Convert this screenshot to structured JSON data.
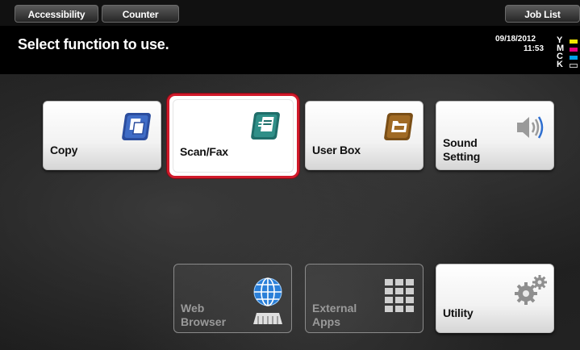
{
  "topbar": {
    "accessibility_label": "Accessibility",
    "counter_label": "Counter",
    "job_list_label": "Job List"
  },
  "message": {
    "text": "Select function to use.",
    "date": "09/18/2012",
    "time": "11:53"
  },
  "toner": [
    {
      "letter": "Y",
      "color": "#f2e600"
    },
    {
      "letter": "M",
      "color": "#e6007e"
    },
    {
      "letter": "C",
      "color": "#00a0e9"
    },
    {
      "letter": "K",
      "color": "#222222"
    }
  ],
  "functions": {
    "copy": {
      "label": "Copy",
      "icon": "copy-icon",
      "color": "#2b4d9e"
    },
    "scan_fax": {
      "label": "Scan/Fax",
      "icon": "scan-fax-icon",
      "color": "#1f6e6a",
      "selected": true
    },
    "user_box": {
      "label": "User Box",
      "icon": "user-box-icon",
      "color": "#8a5a1c"
    },
    "sound": {
      "label_line1": "Sound",
      "label_line2": "Setting",
      "icon": "speaker-icon"
    },
    "web": {
      "label_line1": "Web",
      "label_line2": "Browser",
      "icon": "globe-icon",
      "disabled": true
    },
    "apps": {
      "label_line1": "External",
      "label_line2": "Apps",
      "icon": "grid-icon",
      "disabled": true
    },
    "utility": {
      "label": "Utility",
      "icon": "gears-icon"
    }
  }
}
